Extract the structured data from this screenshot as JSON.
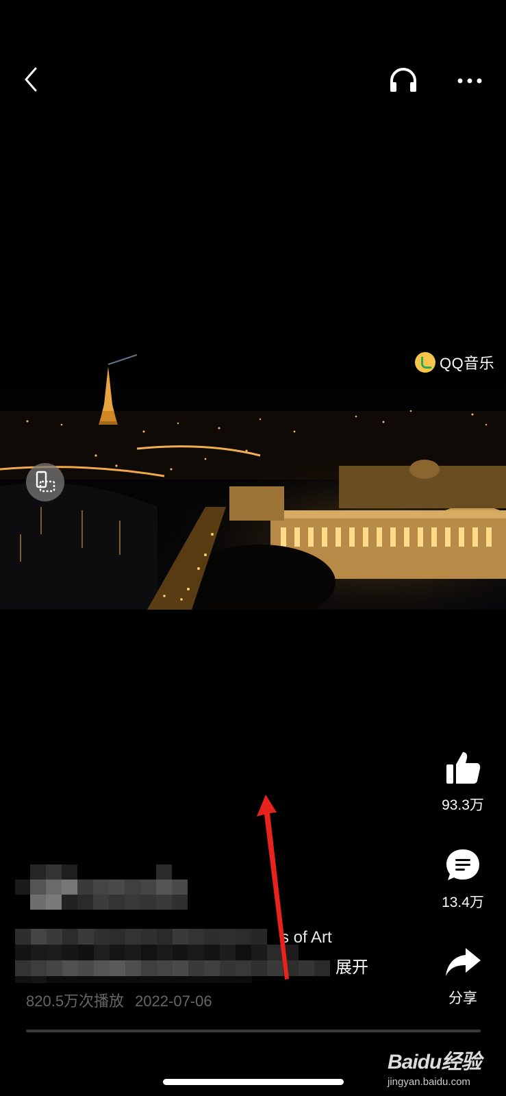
{
  "header": {
    "back_icon": "chevron-left-icon",
    "listen_icon": "headphones-icon",
    "more_icon": "ellipsis-icon"
  },
  "video": {
    "watermark_text": "QQ音乐"
  },
  "actions": {
    "like_count": "93.3万",
    "comment_count": "13.4万",
    "share_label": "分享"
  },
  "post": {
    "description_tail": "s of Art",
    "expand_label": "展开",
    "play_count": "820.5万次播放",
    "date": "2022-07-06"
  },
  "watermark": {
    "brand": "Baidu经验",
    "url": "jingyan.baidu.com"
  },
  "colors": {
    "background": "#000000",
    "annotation_arrow": "#e8231d",
    "meta_text": "#666666"
  }
}
